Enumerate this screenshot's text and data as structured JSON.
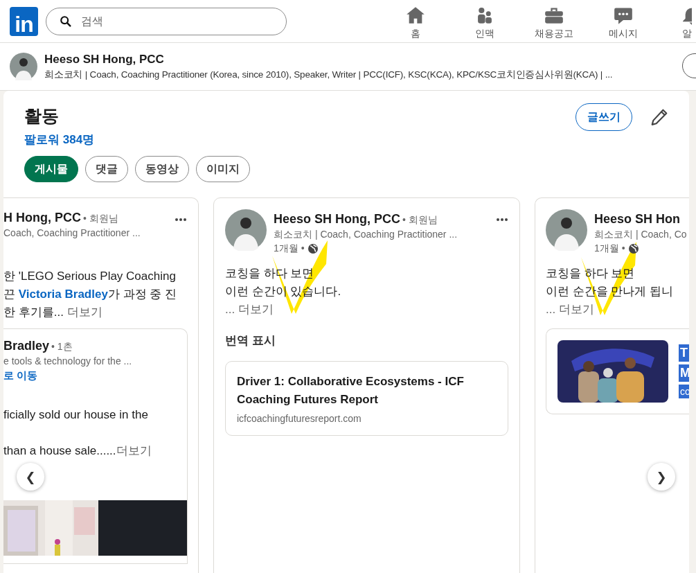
{
  "nav": {
    "logo": "in",
    "search": {
      "placeholder": "검색"
    },
    "items": [
      {
        "label": "홈",
        "kind": "home"
      },
      {
        "label": "인맥",
        "kind": "people"
      },
      {
        "label": "채용공고",
        "kind": "briefcase"
      },
      {
        "label": "메시지",
        "kind": "chat"
      },
      {
        "label": "알",
        "kind": "bell"
      }
    ]
  },
  "profile": {
    "name": "Heeso SH Hong, PCC",
    "headline": "희소코치 | Coach, Coaching Practitioner (Korea, since 2010), Speaker, Writer | PCC(ICF), KSC(KCA), KPC/KSC코치인증심사위원(KCA) | ..."
  },
  "activity": {
    "title": "활동",
    "followers": "팔로워 384명",
    "write_button": "글쓰기",
    "filters": [
      {
        "label": "게시물",
        "selected": true
      },
      {
        "label": "댓글",
        "selected": false
      },
      {
        "label": "동영상",
        "selected": false
      },
      {
        "label": "이미지",
        "selected": false
      }
    ]
  },
  "posts": [
    {
      "kind": "partial-left",
      "name": "H Hong, PCC",
      "relation": "• 회원님",
      "subtitle": "Coach, Coaching Practitioner ...",
      "body": [
        [
          {
            "kind": "text",
            "text": "한 'LEGO Serious Play Coaching"
          }
        ],
        [
          {
            "kind": "text",
            "text": "끈 "
          },
          {
            "kind": "link",
            "text": "Victoria Bradley"
          },
          {
            "kind": "text",
            "text": "가 과정 중 진"
          }
        ],
        [
          {
            "kind": "text",
            "text": "한 후기를... "
          },
          {
            "kind": "more",
            "text": "더보기"
          }
        ]
      ],
      "reshare": {
        "name": "Bradley",
        "relation": "• 1촌",
        "subtitle": "e tools & technology for the ...",
        "link": "로 이동",
        "body": [
          "ficially sold our house in the",
          "than a house sale......"
        ],
        "more": "더보기"
      }
    },
    {
      "kind": "full",
      "name": "Heeso SH Hong, PCC",
      "relation": "• 회원님",
      "subtitle": "희소코치 | Coach, Coaching Practitioner ...",
      "time": "1개월 •",
      "annotated": true,
      "body": [
        [
          {
            "kind": "text",
            "text": "코칭을 하다 보면"
          }
        ],
        [
          {
            "kind": "text",
            "text": "이런 순간이 있습니다."
          }
        ],
        [
          {
            "kind": "more",
            "text": "... 더보기"
          }
        ]
      ],
      "translate": "번역 표시",
      "preview": {
        "title": "Driver 1: Collaborative Ecosystems - ICF Coaching Futures Report",
        "domain": "icfcoachingfuturesreport.com"
      }
    },
    {
      "kind": "partial-right",
      "name": "Heeso SH Hon",
      "subtitle": "희소코치 | Coach, Co",
      "time": "1개월 •",
      "annotated": true,
      "body": [
        [
          {
            "kind": "text",
            "text": "코칭을 하다 보면"
          }
        ],
        [
          {
            "kind": "text",
            "text": "이런 순간을 만나게 됩니"
          }
        ],
        [
          {
            "kind": "more",
            "text": "... 더보기"
          }
        ]
      ],
      "preview": {
        "kind": "picture",
        "highlighted": [
          "T",
          "M",
          "co"
        ]
      }
    }
  ],
  "carousel": {
    "prev": "❮",
    "next": "❯"
  }
}
